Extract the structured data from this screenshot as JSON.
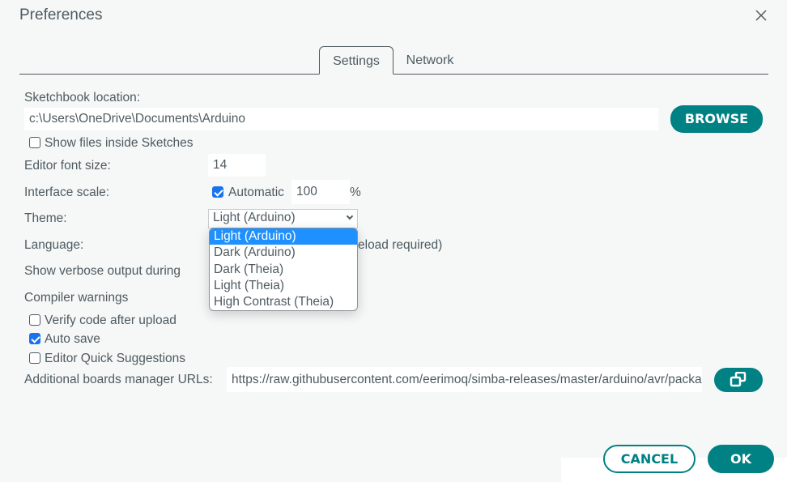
{
  "dialog": {
    "title": "Preferences",
    "close_icon": "close-icon"
  },
  "tabs": [
    {
      "label": "Settings",
      "active": true
    },
    {
      "label": "Network",
      "active": false
    }
  ],
  "settings": {
    "sketchbook_label": "Sketchbook location:",
    "sketchbook_value": "c:\\Users\\OneDrive\\Documents\\Arduino",
    "browse_label": "BROWSE",
    "show_files_label": "Show files inside Sketches",
    "show_files_checked": false,
    "font_size_label": "Editor font size:",
    "font_size_value": "14",
    "interface_scale_label": "Interface scale:",
    "automatic_label": "Automatic",
    "automatic_checked": true,
    "scale_value": "100",
    "scale_unit": "%",
    "theme_label": "Theme:",
    "theme_value": "Light (Arduino)",
    "theme_options": [
      "Light (Arduino)",
      "Dark (Arduino)",
      "Dark (Theia)",
      "Light (Theia)",
      "High Contrast (Theia)"
    ],
    "language_label": "Language:",
    "language_note_visible": "eload required)",
    "verbose_label": "Show verbose output during",
    "compiler_warnings_label": "Compiler warnings",
    "verify_label": "Verify code after upload",
    "verify_checked": false,
    "autosave_label": "Auto save",
    "autosave_checked": true,
    "quick_suggestions_label": "Editor Quick Suggestions",
    "quick_suggestions_checked": false,
    "boards_urls_label": "Additional boards manager URLs:",
    "boards_urls_value": "https://raw.githubusercontent.com/eerimoq/simba-releases/master/arduino/avr/package_simba_avr_index.json",
    "boards_urls_button_icon": "open-window-icon"
  },
  "footer": {
    "cancel_label": "CANCEL",
    "ok_label": "OK"
  },
  "colors": {
    "accent": "#008184",
    "text": "#4e5b61",
    "selection": "#1e90ff",
    "background": "#f6f7f7"
  }
}
